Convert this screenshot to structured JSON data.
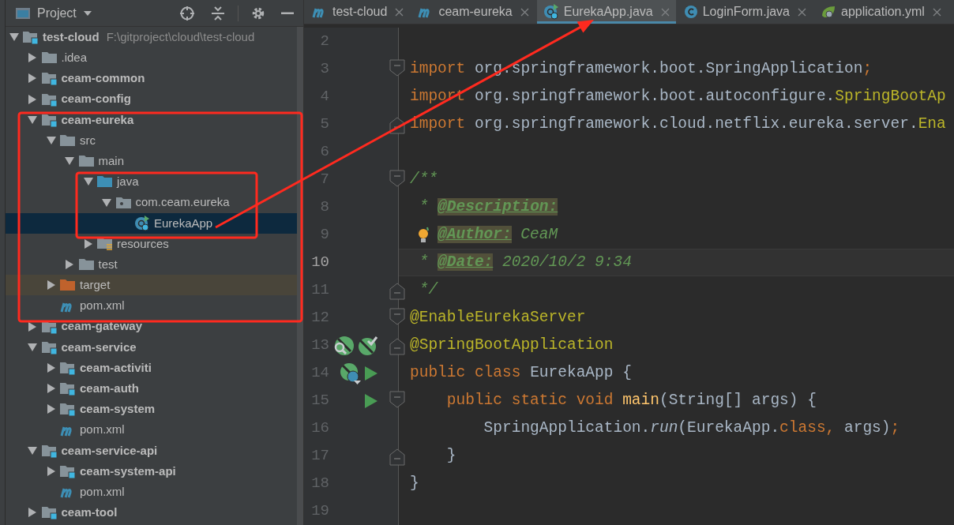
{
  "project_panel": {
    "title": "Project",
    "tree": [
      {
        "label": "test-cloud",
        "path": "F:\\gitproject\\cloud\\test-cloud",
        "kind": "module",
        "expanded": true,
        "selected": false,
        "children": [
          {
            "label": ".idea",
            "kind": "folder",
            "expanded": false,
            "selected": false,
            "highlighted": false
          },
          {
            "label": "ceam-common",
            "kind": "module",
            "expanded": false,
            "selected": false,
            "highlighted": false
          },
          {
            "label": "ceam-config",
            "kind": "module",
            "expanded": false,
            "selected": false,
            "highlighted": false
          },
          {
            "label": "ceam-eureka",
            "kind": "module",
            "expanded": true,
            "selected": false,
            "highlighted": false,
            "children": [
              {
                "label": "src",
                "kind": "folder",
                "expanded": true,
                "selected": false,
                "highlighted": false,
                "children": [
                  {
                    "label": "main",
                    "kind": "folder",
                    "expanded": true,
                    "selected": false,
                    "highlighted": false,
                    "children": [
                      {
                        "label": "java",
                        "kind": "source-root",
                        "expanded": true,
                        "selected": false,
                        "highlighted": false,
                        "children": [
                          {
                            "label": "com.ceam.eureka",
                            "kind": "package",
                            "expanded": true,
                            "selected": false,
                            "highlighted": false,
                            "children": [
                              {
                                "label": "EurekaApp",
                                "kind": "spring-class",
                                "selected": true
                              }
                            ]
                          }
                        ]
                      },
                      {
                        "label": "resources",
                        "kind": "resources-root",
                        "expanded": false,
                        "selected": false,
                        "highlighted": false
                      }
                    ]
                  },
                  {
                    "label": "test",
                    "kind": "folder",
                    "expanded": false,
                    "selected": false,
                    "highlighted": false
                  }
                ]
              },
              {
                "label": "target",
                "kind": "excluded-folder",
                "expanded": false,
                "selected": false,
                "highlighted": true
              },
              {
                "label": "pom.xml",
                "kind": "maven",
                "selected": false,
                "highlighted": false
              }
            ]
          },
          {
            "label": "ceam-gateway",
            "kind": "module",
            "expanded": false,
            "selected": false,
            "highlighted": false
          },
          {
            "label": "ceam-service",
            "kind": "module",
            "expanded": true,
            "selected": false,
            "highlighted": false,
            "children": [
              {
                "label": "ceam-activiti",
                "kind": "module",
                "expanded": false,
                "selected": false,
                "highlighted": false
              },
              {
                "label": "ceam-auth",
                "kind": "module",
                "expanded": false,
                "selected": false,
                "highlighted": false
              },
              {
                "label": "ceam-system",
                "kind": "module",
                "expanded": false,
                "selected": false,
                "highlighted": false
              },
              {
                "label": "pom.xml",
                "kind": "maven",
                "selected": false,
                "highlighted": false
              }
            ]
          },
          {
            "label": "ceam-service-api",
            "kind": "module",
            "expanded": true,
            "selected": false,
            "highlighted": false,
            "children": [
              {
                "label": "ceam-system-api",
                "kind": "module",
                "expanded": false,
                "selected": false,
                "highlighted": false
              },
              {
                "label": "pom.xml",
                "kind": "maven",
                "selected": false,
                "highlighted": false
              }
            ]
          },
          {
            "label": "ceam-tool",
            "kind": "module",
            "expanded": false,
            "selected": false,
            "highlighted": false
          }
        ]
      }
    ]
  },
  "tabs": [
    {
      "label": "test-cloud",
      "kind": "maven",
      "selected": false
    },
    {
      "label": "ceam-eureka",
      "kind": "maven",
      "selected": false
    },
    {
      "label": "EurekaApp.java",
      "kind": "spring-class",
      "selected": true
    },
    {
      "label": "LoginForm.java",
      "kind": "class",
      "selected": false
    },
    {
      "label": "application.yml",
      "kind": "spring-config",
      "selected": false
    }
  ],
  "editor": {
    "lines": [
      {
        "number": "2",
        "current": false
      },
      {
        "number": "3",
        "current": false,
        "fold_start": true,
        "tokens": [
          {
            "text": "import",
            "kind": "keyword"
          },
          {
            "text": " org.springframework.boot.SpringApplication",
            "kind": "plain"
          },
          {
            "text": ";",
            "kind": "keyword"
          }
        ]
      },
      {
        "number": "4",
        "current": false,
        "tokens": [
          {
            "text": "import",
            "kind": "keyword"
          },
          {
            "text": " org.springframework.boot.autoconfigure.",
            "kind": "plain"
          },
          {
            "text": "SpringBootAp",
            "kind": "annotation"
          }
        ]
      },
      {
        "number": "5",
        "current": false,
        "fold_end": true,
        "tokens": [
          {
            "text": "import",
            "kind": "keyword"
          },
          {
            "text": " org.springframework.cloud.netflix.eureka.server.",
            "kind": "plain"
          },
          {
            "text": "Ena",
            "kind": "annotation"
          }
        ]
      },
      {
        "number": "6",
        "current": false
      },
      {
        "number": "7",
        "current": false,
        "fold_start": true,
        "tokens": [
          {
            "text": "/**",
            "kind": "doc"
          }
        ]
      },
      {
        "number": "8",
        "current": false,
        "tokens": [
          {
            "text": " * ",
            "kind": "doc"
          },
          {
            "text": "@Description:",
            "kind": "doctag"
          }
        ]
      },
      {
        "number": "9",
        "current": false,
        "gutter": [
          {
            "kind": "bulb"
          }
        ],
        "tokens": [
          {
            "text": "@Author:",
            "kind": "doctag"
          },
          {
            "text": " CeaM",
            "kind": "doc"
          }
        ]
      },
      {
        "number": "10",
        "current": true,
        "tokens": [
          {
            "text": " * ",
            "kind": "doc"
          },
          {
            "text": "@Date:",
            "kind": "doctag"
          },
          {
            "text": " 2020/10/2 9:34",
            "kind": "doc"
          }
        ]
      },
      {
        "number": "11",
        "current": false,
        "fold_end": true,
        "tokens": [
          {
            "text": " */",
            "kind": "doc"
          }
        ]
      },
      {
        "number": "12",
        "current": false,
        "fold_start": true,
        "tokens": [
          {
            "text": "@EnableEurekaServer",
            "kind": "annotation"
          }
        ]
      },
      {
        "number": "13",
        "current": false,
        "fold_end": true,
        "gutter": [
          {
            "kind": "spring-find"
          },
          {
            "kind": "spring-check"
          }
        ],
        "tokens": [
          {
            "text": "@SpringBootApplication",
            "kind": "annotation"
          }
        ]
      },
      {
        "number": "14",
        "current": false,
        "gutter": [
          {
            "kind": "spring-class"
          },
          {
            "kind": "run"
          }
        ],
        "tokens": [
          {
            "text": "public class ",
            "kind": "keyword"
          },
          {
            "text": "EurekaApp {",
            "kind": "plain"
          }
        ]
      },
      {
        "number": "15",
        "current": false,
        "fold_start": true,
        "gutter": [
          {
            "kind": "run"
          }
        ],
        "tokens": [
          {
            "text": "    public static void ",
            "kind": "keyword"
          },
          {
            "text": "main",
            "kind": "method"
          },
          {
            "text": "(String[] args) {",
            "kind": "plain"
          }
        ]
      },
      {
        "number": "16",
        "current": false,
        "tokens": [
          {
            "text": "        SpringApplication.",
            "kind": "plain"
          },
          {
            "text": "run",
            "kind": "static-call"
          },
          {
            "text": "(EurekaApp.",
            "kind": "plain"
          },
          {
            "text": "class, ",
            "kind": "keyword"
          },
          {
            "text": "args)",
            "kind": "plain"
          },
          {
            "text": ";",
            "kind": "keyword"
          }
        ]
      },
      {
        "number": "17",
        "current": false,
        "fold_end": true,
        "tokens": [
          {
            "text": "    }",
            "kind": "plain"
          }
        ]
      },
      {
        "number": "18",
        "current": false,
        "tokens": [
          {
            "text": "}",
            "kind": "plain"
          }
        ]
      },
      {
        "number": "19",
        "current": false
      }
    ]
  }
}
